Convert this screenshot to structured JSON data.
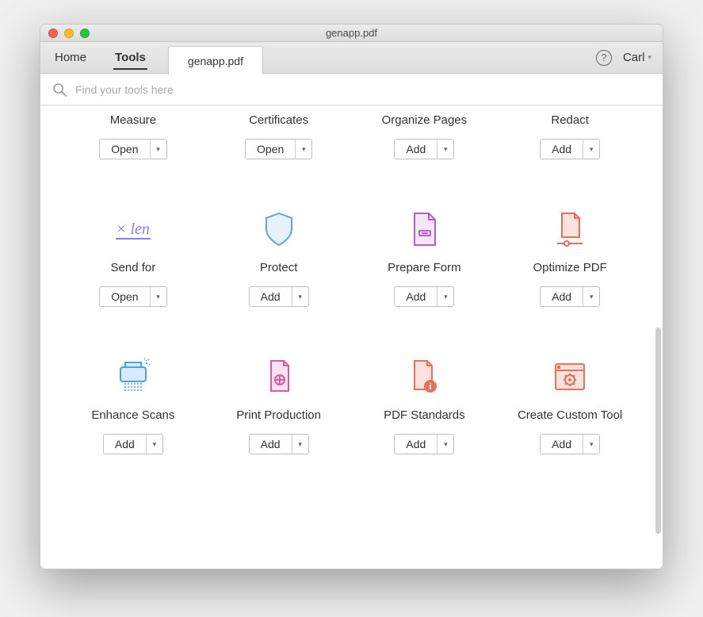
{
  "window": {
    "title": "genapp.pdf"
  },
  "topbar": {
    "home": "Home",
    "tools": "Tools",
    "doc_tab": "genapp.pdf",
    "user": "Carl"
  },
  "search": {
    "placeholder": "Find your tools here"
  },
  "buttons": {
    "open": "Open",
    "add": "Add"
  },
  "tools": {
    "measure": {
      "label": "Measure",
      "action": "Open"
    },
    "certificates": {
      "label": "Certificates",
      "action": "Open"
    },
    "organize_pages": {
      "label": "Organize Pages",
      "action": "Add"
    },
    "redact": {
      "label": "Redact",
      "action": "Add"
    },
    "send_for": {
      "label": "Send for",
      "action": "Open"
    },
    "protect": {
      "label": "Protect",
      "action": "Add"
    },
    "prepare_form": {
      "label": "Prepare Form",
      "action": "Add"
    },
    "optimize_pdf": {
      "label": "Optimize PDF",
      "action": "Add"
    },
    "enhance_scans": {
      "label": "Enhance Scans",
      "action": "Add"
    },
    "print_prod": {
      "label": "Print Production",
      "action": "Add"
    },
    "pdf_standards": {
      "label": "PDF Standards",
      "action": "Add"
    },
    "custom_tool": {
      "label": "Create Custom Tool",
      "action": "Add"
    }
  }
}
